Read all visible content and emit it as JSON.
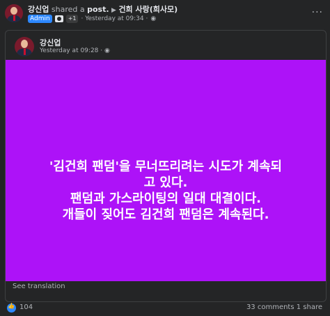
{
  "post": {
    "author": "강신업",
    "action": "shared a",
    "object": "post.",
    "arrow": "▶",
    "group": "건희 사랑(희사모)",
    "badge": "Admin",
    "plus": "+1",
    "time": "· Yesterday at 09:34 ·",
    "more": "···"
  },
  "shared_post": {
    "author": "강신업",
    "time": "Yesterday at 09:28 ·",
    "background": "#ad12f8",
    "text_lines": [
      "'김건희 팬덤'을 무너뜨리려는 시도가 계속되",
      "고 있다.",
      "팬덤과 가스라이팅의 일대 대결이다.",
      "개들이 짖어도 김건희 팬덤은 계속된다."
    ],
    "see_translation": "See translation"
  },
  "footer": {
    "reactions": "104",
    "stats": "33 comments  1 share"
  },
  "colors": {
    "background": "#242526",
    "accent": "#2d88ff",
    "muted": "#b0b3b8"
  }
}
